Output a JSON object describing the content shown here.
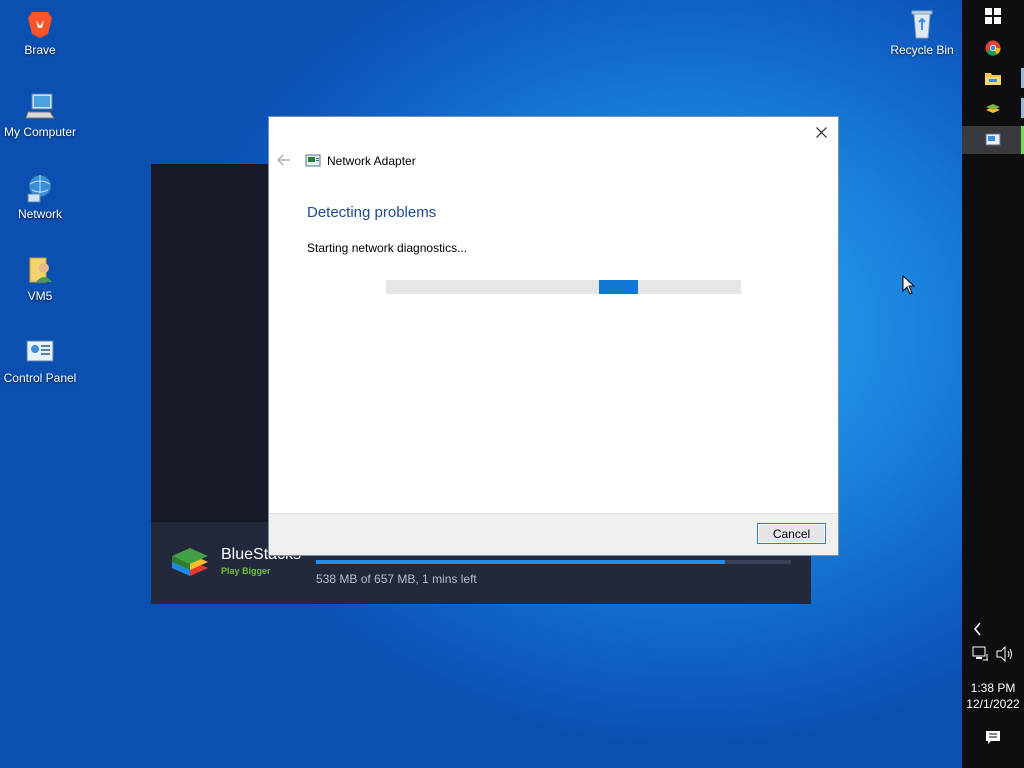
{
  "desktop": {
    "icons": [
      {
        "label": "Brave"
      },
      {
        "label": "My Computer"
      },
      {
        "label": "Network"
      },
      {
        "label": "VM5"
      },
      {
        "label": "Control Panel"
      },
      {
        "label": "Recycle Bin"
      }
    ]
  },
  "bluestacks": {
    "name": "BlueStacks",
    "tagline": "Play Bigger",
    "download_progress": 0.86,
    "status": "538 MB of 657 MB, 1 mins left"
  },
  "dialog": {
    "title": "Network Adapter",
    "heading": "Detecting problems",
    "status": "Starting network diagnostics...",
    "cancel_label": "Cancel"
  },
  "taskbar": {
    "time": "1:38 PM",
    "date": "12/1/2022"
  },
  "colors": {
    "accent": "#0f78d4",
    "heading": "#204a8c",
    "taskbar": "#0e0e10"
  }
}
